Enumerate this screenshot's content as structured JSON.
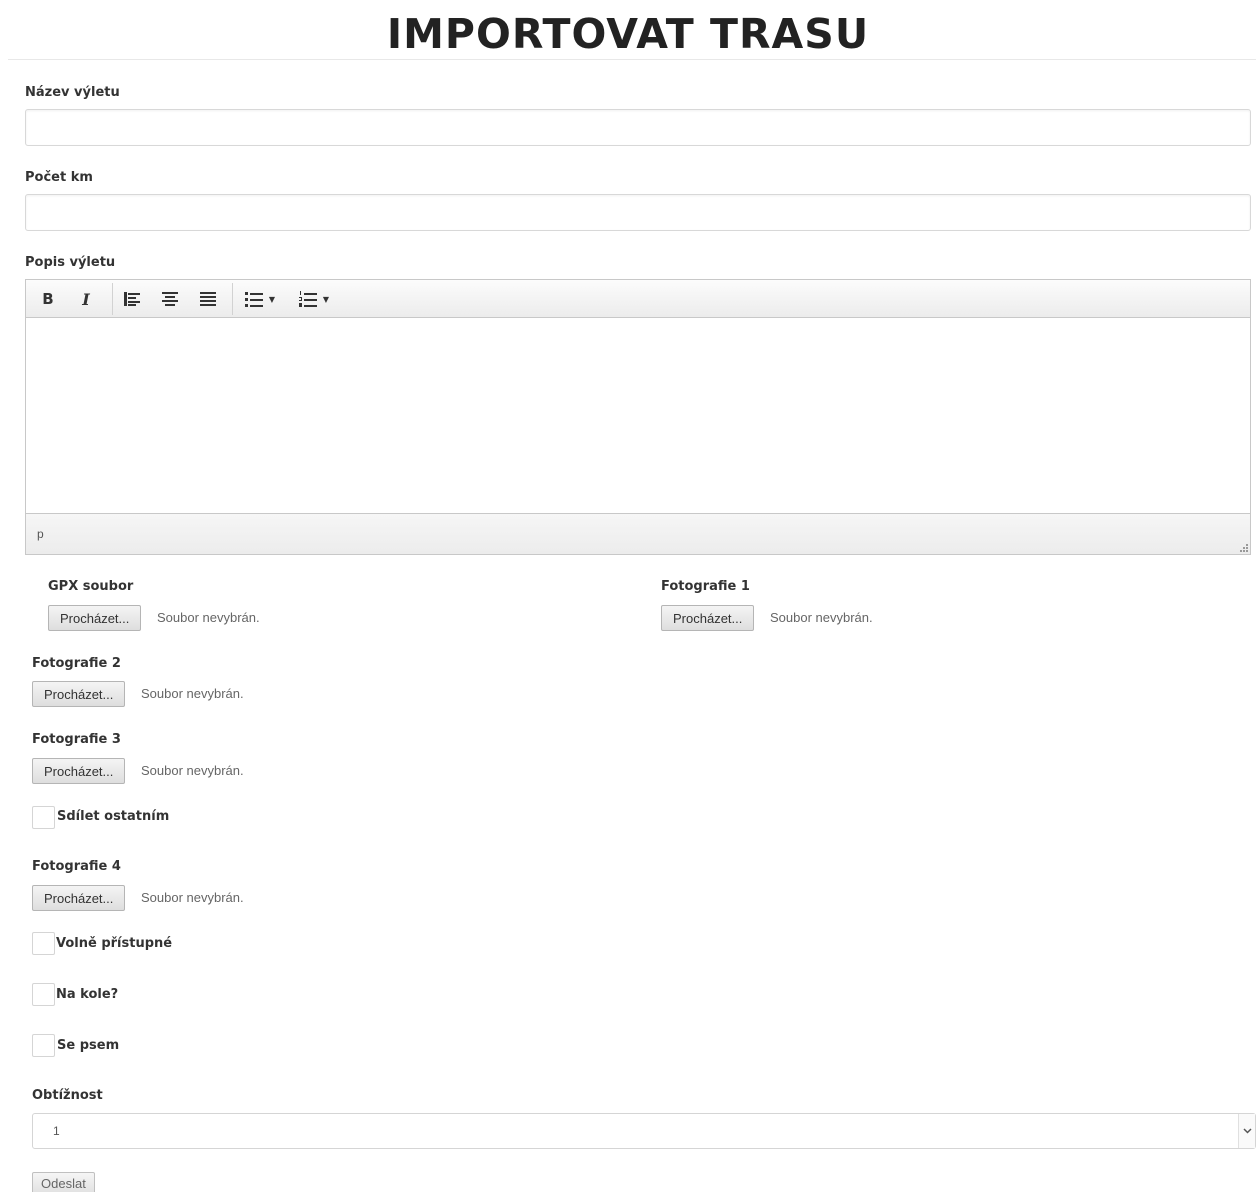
{
  "page": {
    "title": "IMPORTOVAT TRASU"
  },
  "form": {
    "trip_name": {
      "label": "Název výletu",
      "value": ""
    },
    "distance": {
      "label": "Počet km",
      "value": ""
    },
    "description": {
      "label": "Popis výletu",
      "toolbar": {
        "bold": "B",
        "italic": "I",
        "align_left": "align-left-icon",
        "align_center": "align-center-icon",
        "align_justify": "align-justify-icon",
        "bullet_list": "bullet-list-icon",
        "numbered_list": "numbered-list-icon"
      },
      "status_path": "p"
    },
    "gpx": {
      "label": "GPX soubor",
      "button": "Procházet...",
      "status": "Soubor nevybrán."
    },
    "photo1": {
      "label": "Fotografie 1",
      "button": "Procházet...",
      "status": "Soubor nevybrán."
    },
    "photo2": {
      "label": "Fotografie 2",
      "button": "Procházet...",
      "status": "Soubor nevybrán."
    },
    "photo3": {
      "label": "Fotografie 3",
      "button": "Procházet...",
      "status": "Soubor nevybrán."
    },
    "share": {
      "label": "Sdílet ostatním",
      "checked": false
    },
    "photo4": {
      "label": "Fotografie 4",
      "button": "Procházet...",
      "status": "Soubor nevybrán."
    },
    "public": {
      "label": "Volně přístupné",
      "checked": false
    },
    "bike": {
      "label": "Na kole?",
      "checked": false
    },
    "dog": {
      "label": "Se psem",
      "checked": false
    },
    "difficulty": {
      "label": "Obtížnost",
      "value": "1"
    },
    "submit": {
      "label": "Odeslat"
    }
  }
}
